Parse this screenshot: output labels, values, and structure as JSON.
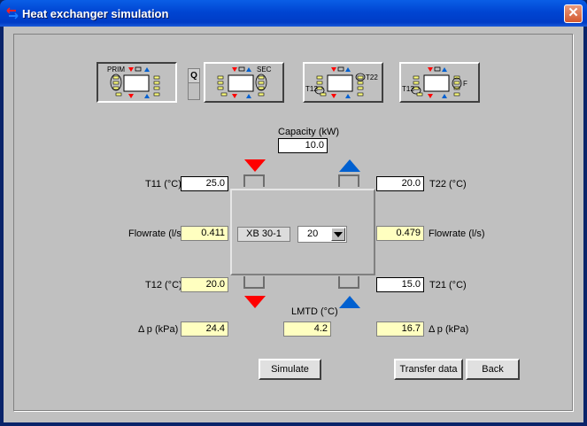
{
  "window": {
    "title": "Heat exchanger simulation",
    "close_label": "✕"
  },
  "mode_buttons": [
    {
      "label": "PRIM",
      "active": true
    },
    {
      "label": "SEC",
      "active": false
    },
    {
      "label_left": "T12",
      "label_right": "T22",
      "active": false
    },
    {
      "label_left": "T12",
      "label_right": "F",
      "active": false
    }
  ],
  "q_toggle": {
    "label": "Q"
  },
  "capacity": {
    "label": "Capacity (kW)",
    "value": "10.0"
  },
  "primary": {
    "t11_label": "T11 (°C)",
    "t11_value": "25.0",
    "flow_label": "Flowrate (l/s)",
    "flow_value": "0.411",
    "t12_label": "T12 (°C)",
    "t12_value": "20.0",
    "dp_label": "Δ  p (kPa)",
    "dp_value": "24.4"
  },
  "secondary": {
    "t22_label": "T22 (°C)",
    "t22_value": "20.0",
    "flow_label": "Flowrate (l/s)",
    "flow_value": "0.479",
    "t21_label": "T21 (°C)",
    "t21_value": "15.0",
    "dp_label": "Δ p (kPa)",
    "dp_value": "16.7"
  },
  "exchanger": {
    "model": "XB 30-1",
    "plates": "20"
  },
  "lmtd": {
    "label": "LMTD (°C)",
    "value": "4.2"
  },
  "buttons": {
    "simulate": "Simulate",
    "transfer": "Transfer data",
    "back": "Back"
  },
  "colors": {
    "hot": "#ff0000",
    "cold": "#0060d0",
    "readonly_bg": "#ffffc0"
  }
}
